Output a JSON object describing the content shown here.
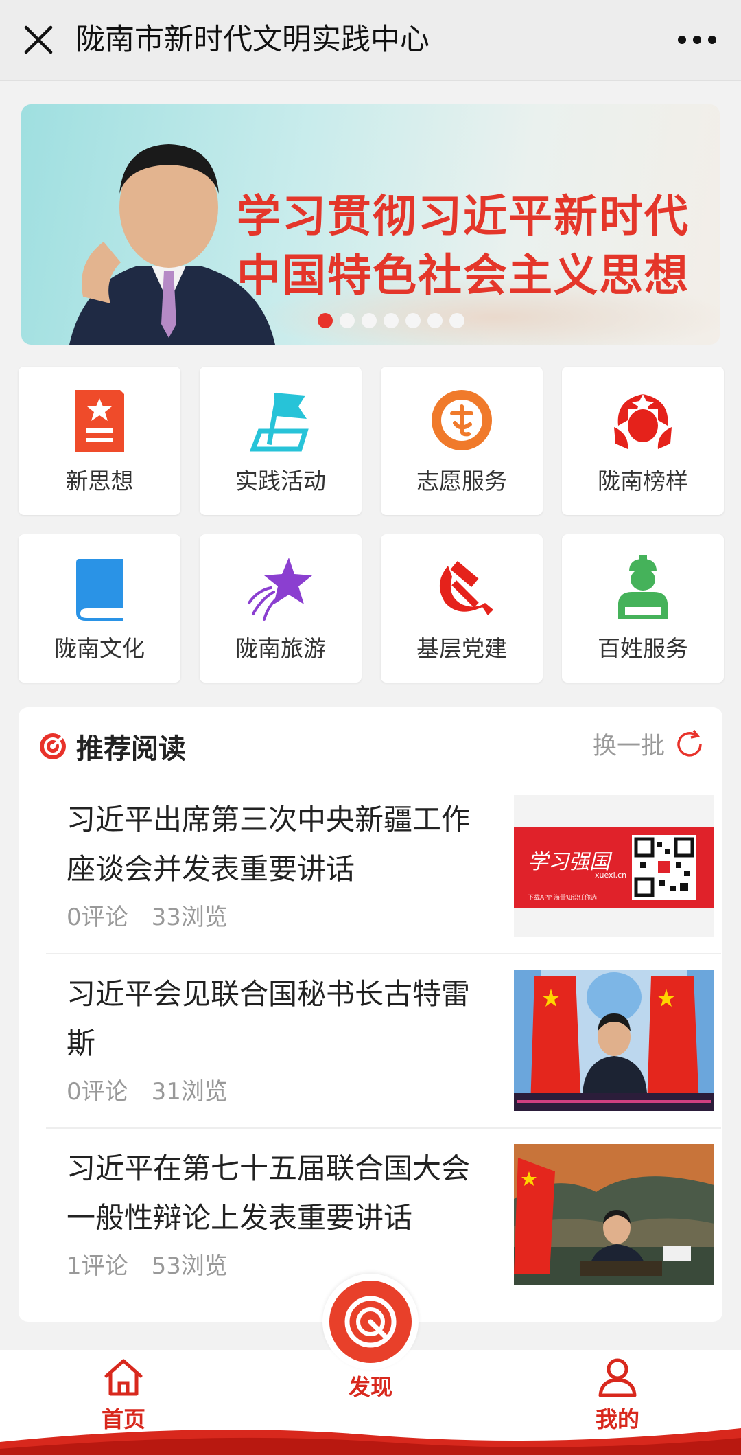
{
  "header": {
    "title": "陇南市新时代文明实践中心"
  },
  "banner": {
    "line1": "学习贯彻习近平新时代",
    "line2": "中国特色社会主义思想",
    "slide_count": 7,
    "active_slide": 1
  },
  "grid": [
    {
      "label": "新思想",
      "icon": "document-star-icon"
    },
    {
      "label": "实践活动",
      "icon": "flag-icon"
    },
    {
      "label": "志愿服务",
      "icon": "volunteer-badge-icon"
    },
    {
      "label": "陇南榜样",
      "icon": "role-model-icon"
    },
    {
      "label": "陇南文化",
      "icon": "book-icon"
    },
    {
      "label": "陇南旅游",
      "icon": "shooting-star-icon"
    },
    {
      "label": "基层党建",
      "icon": "hammer-sickle-icon"
    },
    {
      "label": "百姓服务",
      "icon": "service-person-icon"
    }
  ],
  "recommend": {
    "title": "推荐阅读",
    "refresh_label": "换一批",
    "articles": [
      {
        "title": "习近平出席第三次中央新疆工作座谈会并发表重要讲话",
        "comments": "0评论",
        "views": "33浏览",
        "thumb_text": "学习强国",
        "thumb_sub": "xuexi.cn",
        "thumb_caption": "下载APP 海量知识任你选"
      },
      {
        "title": "习近平会见联合国秘书长古特雷斯",
        "comments": "0评论",
        "views": "31浏览"
      },
      {
        "title": "习近平在第七十五届联合国大会一般性辩论上发表重要讲话",
        "comments": "1评论",
        "views": "53浏览"
      }
    ]
  },
  "nav": {
    "home": "首页",
    "find": "发现",
    "me": "我的"
  },
  "colors": {
    "accent": "#e8322a",
    "nav_red": "#d8281d"
  }
}
